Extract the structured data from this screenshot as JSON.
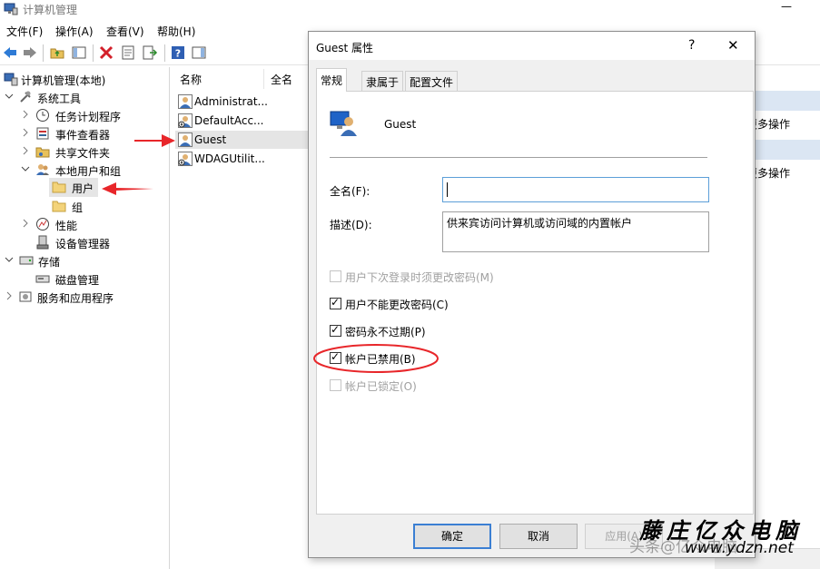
{
  "window": {
    "title": "计算机管理",
    "minimize": "—"
  },
  "menu": [
    "文件(F)",
    "操作(A)",
    "查看(V)",
    "帮助(H)"
  ],
  "tree": {
    "root": "计算机管理(本地)",
    "system_tools": "系统工具",
    "task_scheduler": "任务计划程序",
    "event_viewer": "事件查看器",
    "shared_folders": "共享文件夹",
    "local_users_groups": "本地用户和组",
    "users": "用户",
    "groups": "组",
    "performance": "性能",
    "device_manager": "设备管理器",
    "storage": "存储",
    "disk_management": "磁盘管理",
    "services_apps": "服务和应用程序"
  },
  "list": {
    "col_name": "名称",
    "col_fullname": "全名",
    "rows": [
      "Administrat...",
      "DefaultAcc...",
      "Guest",
      "WDAGUtilit..."
    ]
  },
  "actions": {
    "more_actions_1": "更多操作",
    "more_actions_2": "更多操作"
  },
  "dialog": {
    "title": "Guest 属性",
    "help": "?",
    "close": "✕",
    "tabs": [
      "常规",
      "隶属于",
      "配置文件"
    ],
    "user_name": "Guest",
    "fullname_label": "全名(F):",
    "fullname_value": "",
    "description_label": "描述(D):",
    "description_value": "供来宾访问计算机或访问域的内置帐户",
    "checkboxes": [
      {
        "label": "用户下次登录时须更改密码(M)",
        "checked": false,
        "enabled": false
      },
      {
        "label": "用户不能更改密码(C)",
        "checked": true,
        "enabled": true
      },
      {
        "label": "密码永不过期(P)",
        "checked": true,
        "enabled": true
      },
      {
        "label": "帐户已禁用(B)",
        "checked": true,
        "enabled": true
      },
      {
        "label": "帐户已锁定(O)",
        "checked": false,
        "enabled": false
      }
    ],
    "buttons": {
      "ok": "确定",
      "cancel": "取消",
      "apply": "应用(A)"
    }
  },
  "watermark": {
    "site_name": "藤庄亿众电脑",
    "url": "www.ydzn.net",
    "faint": "头条@亿众电脑"
  },
  "colors": {
    "annotation_red": "#e8262a",
    "selection": "#e5e5e5",
    "focus_blue": "#3b7fd3"
  }
}
